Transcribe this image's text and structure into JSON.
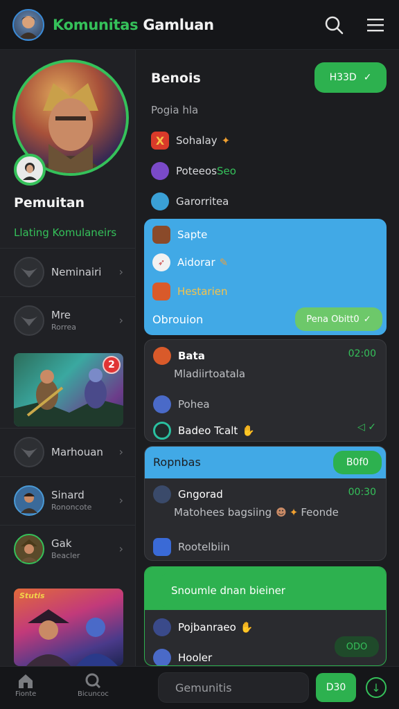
{
  "header": {
    "title_green": "Komunitas",
    "title_white": " Gamluan",
    "icons": [
      "search-icon",
      "menu-icon"
    ]
  },
  "sidebar": {
    "profile_name": "Pemuitan",
    "profile_sub": "Llating Komulaneirs",
    "items": [
      {
        "label": "Neminairi",
        "sub": ""
      },
      {
        "label": "Mre",
        "sub": "Rorrea"
      },
      {
        "label": "Marhouan",
        "sub": ""
      },
      {
        "label": "Sinard",
        "sub": "Rononcote"
      },
      {
        "label": "Gak",
        "sub": "Beacler"
      }
    ],
    "card_badge": "2",
    "card2_label": "Stutis"
  },
  "main": {
    "title": "Benois",
    "top_pill": "H33D",
    "section_label": "Pogia hla",
    "list": [
      {
        "label": "Sohalay",
        "accent": "",
        "icon": "x-icon"
      },
      {
        "label": "Poteeos",
        "accent": " Seo",
        "icon": "character-icon"
      },
      {
        "label": "Garorritea",
        "accent": "",
        "icon": "sword-icon"
      }
    ],
    "blue_card": {
      "rows": [
        {
          "label": "Sapte",
          "icon": "character-icon"
        },
        {
          "label": "Aidorar",
          "icon": "item-icon"
        },
        {
          "label": "Hestarien",
          "icon": "shield-icon"
        }
      ],
      "footer": "Obrouion",
      "pill": "Pena Obitt0"
    },
    "dark_card": {
      "name": "Bata",
      "time": "02:00",
      "sub": "Mladiirtoatala",
      "row2": "Pohea",
      "row3": "Badeo Tcalt"
    },
    "card3": {
      "header": "Ropnbas",
      "pill": "B0f0",
      "name": "Gngorad",
      "time": "00:30",
      "sub": "Matohees bagsiing",
      "sub2": "Feonde",
      "row2": "Rootelbiin"
    },
    "card4": {
      "bubble": "Snoumle dnan bieiner",
      "row1": "Pojbanraeo",
      "row2": "Hooler",
      "pill": "ODO"
    }
  },
  "bottom": {
    "home_label": "Fionte",
    "discover_label": "Bicuncoc",
    "search_placeholder": "Gemunitis",
    "pill": "D30",
    "accent": "#35c15a",
    "blue": "#41a9e6"
  }
}
